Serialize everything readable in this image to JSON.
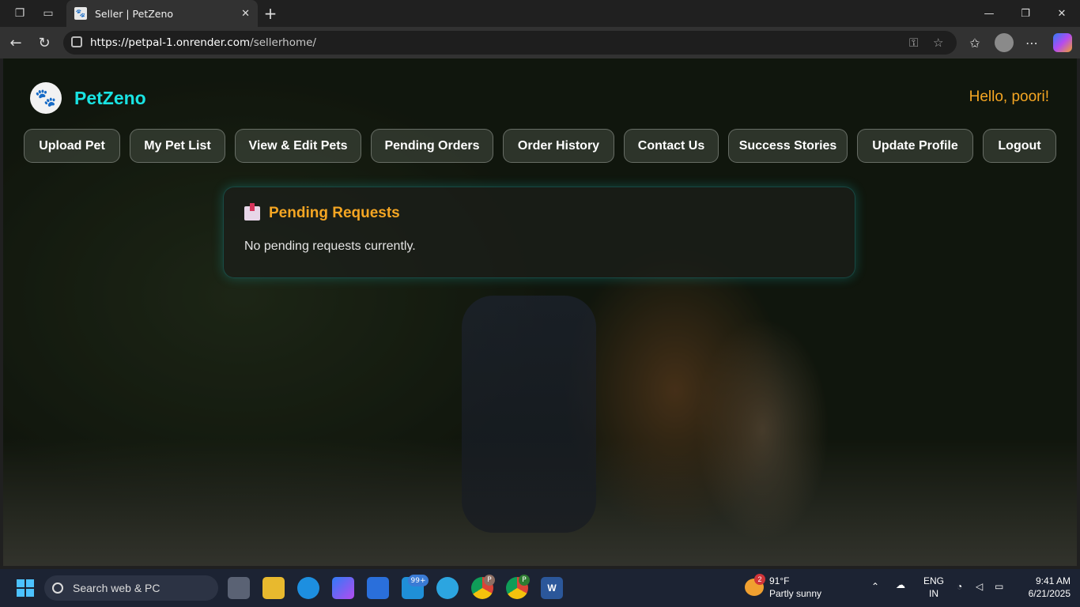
{
  "browser": {
    "tab_title": "Seller | PetZeno",
    "url_host": "https://petpal-1.onrender.com",
    "url_path": "/sellerhome/"
  },
  "site": {
    "brand": "PetZeno",
    "greeting": "Hello, poori!",
    "nav": [
      "Upload Pet",
      "My Pet List",
      "View & Edit Pets",
      "Pending Orders",
      "Order History",
      "Contact Us",
      "Success Stories",
      "Update Profile",
      "Logout"
    ]
  },
  "card": {
    "title": "Pending Requests",
    "message": "No pending requests currently."
  },
  "taskbar": {
    "search_placeholder": "Search web & PC",
    "widget_badge": "99+",
    "weather_badge": "2",
    "temperature": "91°F",
    "condition": "Partly sunny",
    "lang": "ENG",
    "region": "IN",
    "time": "9:41 AM",
    "date": "6/21/2025",
    "chrome_profile_1": "P",
    "chrome_profile_2": "P",
    "word_letter": "W"
  },
  "colors": {
    "brand": "#19e3e3",
    "accent": "#f5a623"
  }
}
